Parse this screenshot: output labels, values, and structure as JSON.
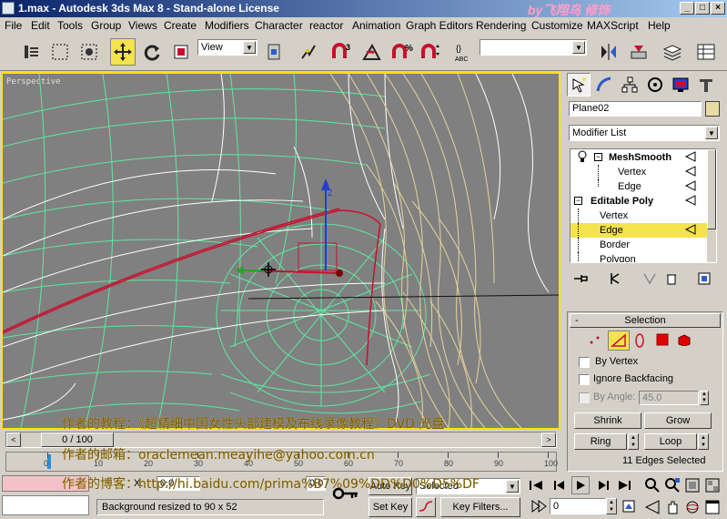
{
  "window": {
    "title": "1.max - Autodesk 3ds Max 8 - Stand-alone License",
    "watermark_title": "by飞翔鸟 修饰"
  },
  "menu": [
    "File",
    "Edit",
    "Tools",
    "Group",
    "Views",
    "Create",
    "Modifiers",
    "Character",
    "reactor",
    "Animation",
    "Graph Editors",
    "Rendering",
    "Customize",
    "MAXScript",
    "Help"
  ],
  "toolbar": {
    "ref_coord": "View",
    "spinner_snap_label": "3",
    "named_selection": ""
  },
  "viewport": {
    "label": "Perspective"
  },
  "command_panel": {
    "object_name": "Plane02",
    "object_color": "#e9dca0",
    "modifier_list_label": "Modifier List",
    "stack": [
      {
        "label": "MeshSmooth",
        "bold": true,
        "indent": 0
      },
      {
        "label": "Vertex",
        "bold": false,
        "indent": 1
      },
      {
        "label": "Edge",
        "bold": false,
        "indent": 1
      },
      {
        "label": "Editable Poly",
        "bold": true,
        "indent": 0
      },
      {
        "label": "Vertex",
        "bold": false,
        "indent": 1
      },
      {
        "label": "Edge",
        "bold": false,
        "indent": 1,
        "selected": true
      },
      {
        "label": "Border",
        "bold": false,
        "indent": 1
      },
      {
        "label": "Polygon",
        "bold": false,
        "indent": 1
      }
    ],
    "selection_rollout": {
      "title": "Selection",
      "by_vertex": "By Vertex",
      "ignore_backfacing": "Ignore Backfacing",
      "by_angle": "By Angle:",
      "by_angle_value": "45.0",
      "shrink": "Shrink",
      "grow": "Grow",
      "ring": "Ring",
      "loop": "Loop",
      "status": "11 Edges Selected"
    }
  },
  "timeline": {
    "frame": "0 / 100",
    "ticks": [
      "0",
      "10",
      "20",
      "30",
      "40",
      "50",
      "60",
      "70",
      "80",
      "90",
      "100"
    ]
  },
  "status": {
    "x_label": "X:",
    "x_value": "0.0",
    "z_value": "0.0",
    "prompt": "Background resized to 90 x 52",
    "auto_key": "Auto Key",
    "selected": "Selected",
    "set_key": "Set Key",
    "key_filters": "Key Filters...",
    "frame_value": "0"
  },
  "watermark_lines": [
    "作者的教程：《超精细中国女性头部建模及布线录像教程》DVD 光盘",
    "作者的邮箱：oraclemean.meayihe@yahoo.com.cn",
    "作者的博客：http://hi.baidu.com/prima%B7%09%DD%D0%D5%DF"
  ],
  "colors": {
    "title_start": "#0a246a",
    "title_end": "#a6caf0",
    "active_viewport_border": "#ffe400",
    "selection_highlight": "#f5e34e",
    "wire_green": "#5ee8a0",
    "wire_white": "#ffffff",
    "wire_tan": "#e6d49a",
    "wire_red": "#c8102e"
  }
}
